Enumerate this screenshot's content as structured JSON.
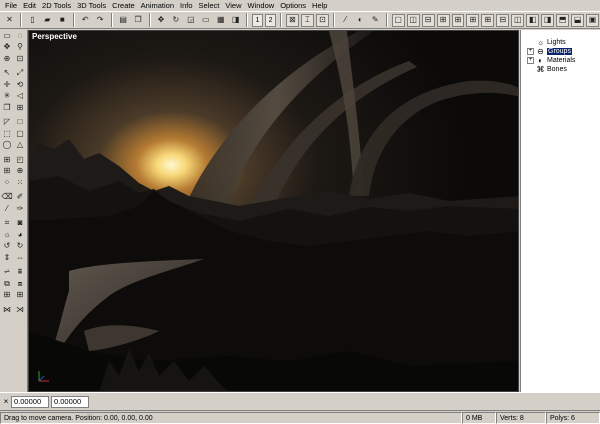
{
  "menubar": {
    "items": [
      "File",
      "Edit",
      "2D Tools",
      "3D Tools",
      "Create",
      "Animation",
      "Info",
      "Select",
      "View",
      "Window",
      "Options",
      "Help"
    ]
  },
  "toolbar": {
    "view_one": "1",
    "view_two": "2"
  },
  "viewport": {
    "label": "Perspective"
  },
  "tree": {
    "items": [
      {
        "label": "Lights",
        "icon": "light-icon"
      },
      {
        "label": "Groups",
        "icon": "group-icon"
      },
      {
        "label": "Materials",
        "icon": "material-icon"
      },
      {
        "label": "Bones",
        "icon": "bone-icon"
      }
    ]
  },
  "coords": {
    "x_label": "×",
    "value1": "0.00000",
    "value2": "0.00000"
  },
  "status": {
    "message": "Drag to move camera. Position: 0.00, 0.00, 0.00",
    "memory": "0 MB",
    "verts": "Verts: 8",
    "polys": "Polys: 6"
  }
}
